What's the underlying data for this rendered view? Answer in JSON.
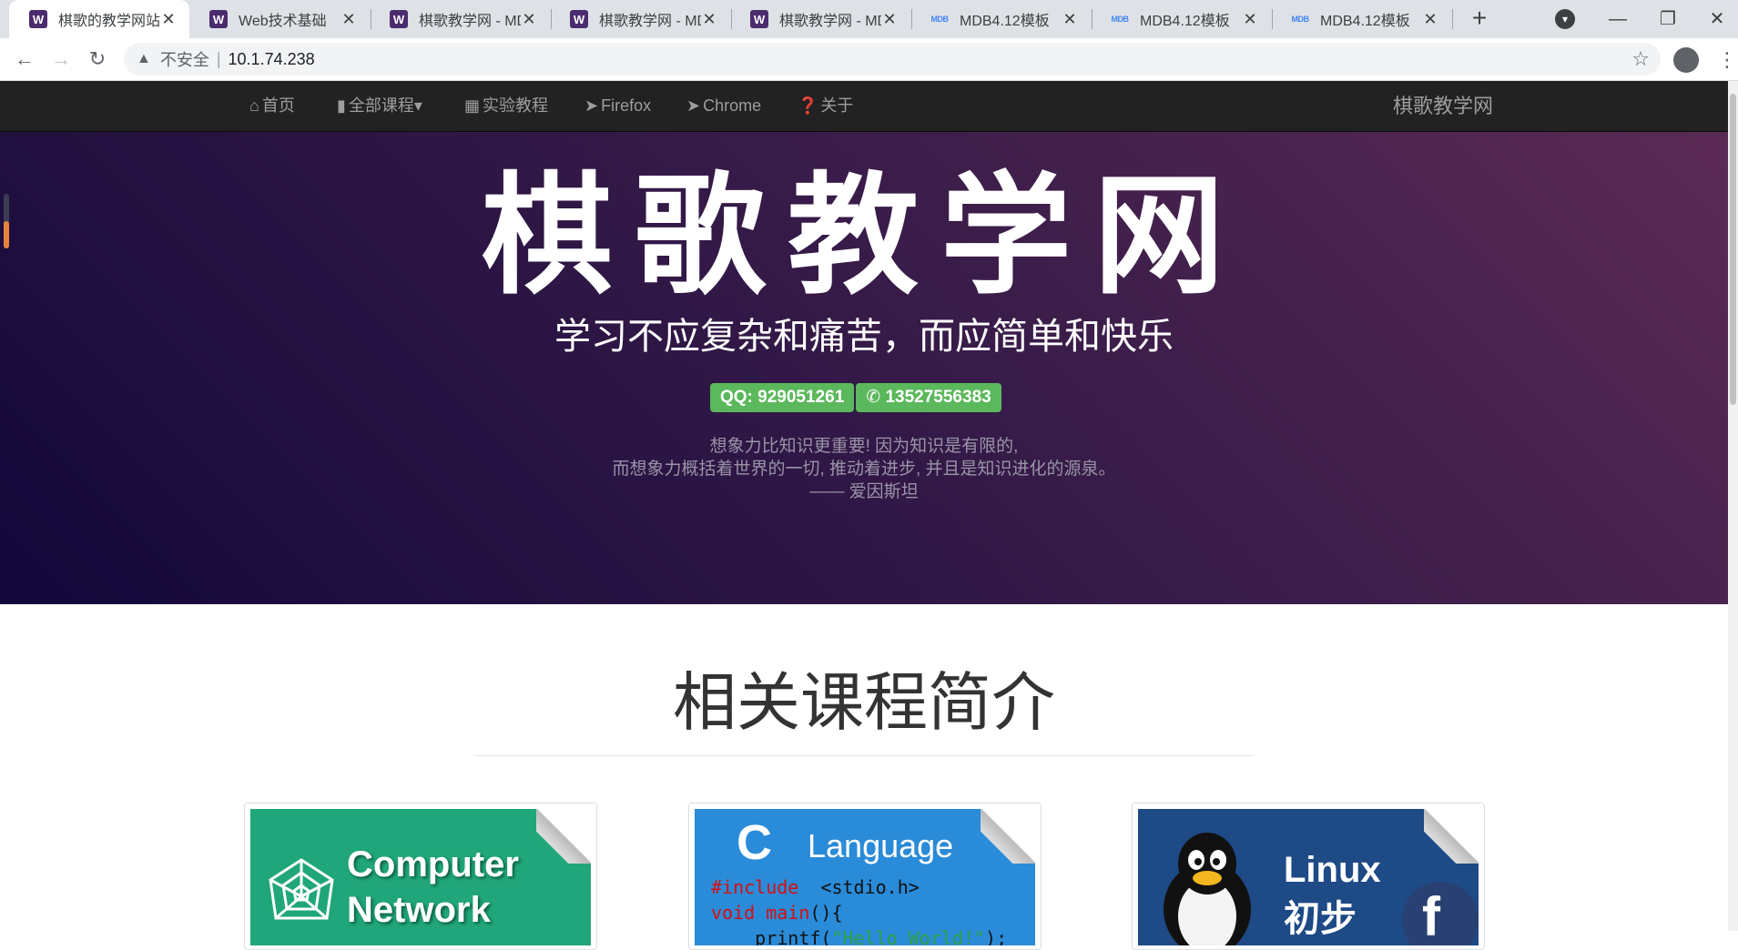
{
  "browser": {
    "tabs": [
      {
        "title": "棋歌的教学网站",
        "favicon": "W",
        "active": true
      },
      {
        "title": "Web技术基础",
        "favicon": "W",
        "active": false
      },
      {
        "title": "棋歌教学网 - MD",
        "favicon": "W",
        "active": false
      },
      {
        "title": "棋歌教学网 - MD",
        "favicon": "W",
        "active": false
      },
      {
        "title": "棋歌教学网 - MD",
        "favicon": "W",
        "active": false
      },
      {
        "title": "MDB4.12模板",
        "favicon": "MDB",
        "active": false
      },
      {
        "title": "MDB4.12模板",
        "favicon": "MDB",
        "active": false
      },
      {
        "title": "MDB4.12模板",
        "favicon": "MDB",
        "active": false
      }
    ],
    "close_glyph": "✕",
    "new_tab_glyph": "+",
    "address": {
      "security_label": "不安全",
      "separator": "|",
      "url": "10.1.74.238"
    }
  },
  "site": {
    "nav": {
      "items": [
        {
          "label": "首页",
          "icon": "home-icon",
          "glyph": "⌂"
        },
        {
          "label": "全部课程",
          "icon": "book-icon",
          "glyph": "▮",
          "caret": "▾"
        },
        {
          "label": "实验教程",
          "icon": "grid-icon",
          "glyph": "▦"
        },
        {
          "label": "Firefox",
          "icon": "send-icon",
          "glyph": "➤"
        },
        {
          "label": "Chrome",
          "icon": "send-icon",
          "glyph": "➤"
        },
        {
          "label": "关于",
          "icon": "question-icon",
          "glyph": "❓"
        }
      ],
      "brand": "棋歌教学网"
    },
    "hero": {
      "title": "棋歌教学网",
      "subtitle": "学习不应复杂和痛苦，而应简单和快乐",
      "qq_badge": "QQ: 929051261",
      "phone_badge": "13527556383",
      "phone_glyph": "✆",
      "quote_line1": "想象力比知识更重要! 因为知识是有限的,",
      "quote_line2": "而想象力概括着世界的一切, 推动着进步, 并且是知识进化的源泉。",
      "quote_author": "—— 爱因斯坦"
    },
    "courses": {
      "heading": "相关课程简介",
      "cards": [
        {
          "line1": "Computer",
          "line2": "Network"
        },
        {
          "letter": "C",
          "word": "Language",
          "code1_kw": "#include",
          "code1_rest": "  <stdio.h>",
          "code2_kw": "void main",
          "code2_rest": "(){",
          "code3_pre": "    printf(",
          "code3_str": "\"Hello World!\"",
          "code3_post": ");"
        },
        {
          "line1": "Linux",
          "line2": "初步"
        }
      ]
    }
  },
  "colors": {
    "navbar_bg": "#222222",
    "badge_green": "#5cb85c",
    "hero_dark": "#12083a",
    "hero_light": "#5b2a54"
  }
}
